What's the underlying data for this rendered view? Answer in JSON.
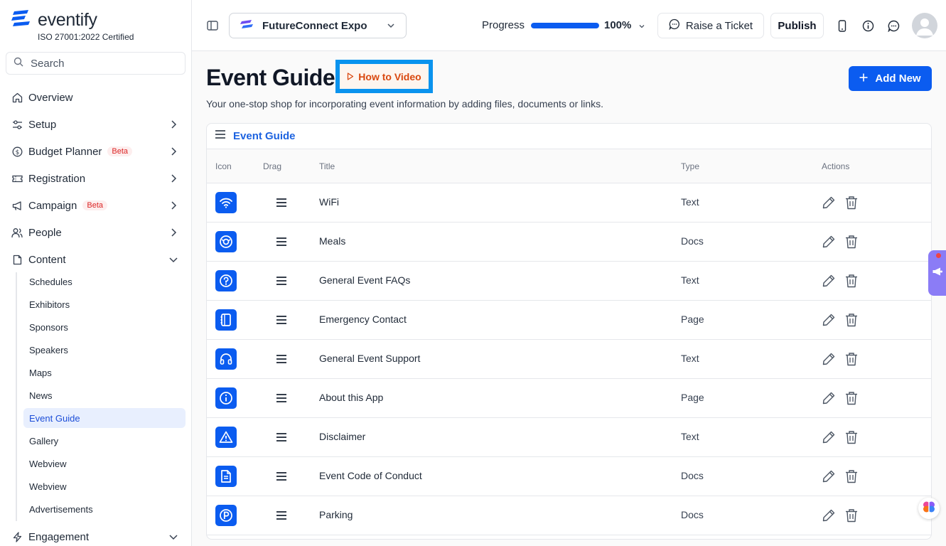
{
  "brand": {
    "name": "eventify",
    "cert": "ISO 27001:2022 Certified",
    "color": "#0b5cf0"
  },
  "search": {
    "placeholder": "Search"
  },
  "sidebar": {
    "items": [
      {
        "label": "Overview",
        "icon": "home-icon"
      },
      {
        "label": "Setup",
        "icon": "sliders-icon"
      },
      {
        "label": "Budget Planner",
        "icon": "dollar-circle-icon",
        "badge": "Beta"
      },
      {
        "label": "Registration",
        "icon": "ticket-icon"
      },
      {
        "label": "Campaign",
        "icon": "megaphone-icon",
        "badge": "Beta"
      },
      {
        "label": "People",
        "icon": "users-icon"
      },
      {
        "label": "Content",
        "icon": "content-icon"
      },
      {
        "label": "Engagement",
        "icon": "bolt-icon"
      }
    ],
    "sub_items": [
      "Schedules",
      "Exhibitors",
      "Sponsors",
      "Speakers",
      "Maps",
      "News",
      "Event Guide",
      "Gallery",
      "Webview",
      "Webview",
      "Advertisements"
    ],
    "active_sub": "Event Guide"
  },
  "topbar": {
    "event_name": "FutureConnect Expo",
    "progress_label": "Progress",
    "progress_value": "100%",
    "progress_fraction": 1.0,
    "ticket_label": "Raise a Ticket",
    "publish_label": "Publish"
  },
  "main": {
    "title": "Event Guide",
    "how_to": "How to Video",
    "subtitle": "Your one-stop shop for incorporating event information by adding files, documents or links.",
    "add_label": "Add New",
    "card_title": "Event Guide",
    "columns": {
      "icon": "Icon",
      "drag": "Drag",
      "title": "Title",
      "type": "Type",
      "actions": "Actions"
    },
    "rows": [
      {
        "title": "WiFi",
        "type": "Text",
        "icon": "wifi-icon"
      },
      {
        "title": "Meals",
        "type": "Docs",
        "icon": "meals-icon"
      },
      {
        "title": "General Event FAQs",
        "type": "Text",
        "icon": "question-icon"
      },
      {
        "title": "Emergency Contact",
        "type": "Page",
        "icon": "contact-book-icon"
      },
      {
        "title": "General Event Support",
        "type": "Text",
        "icon": "headphones-icon"
      },
      {
        "title": "About this App",
        "type": "Page",
        "icon": "info-icon"
      },
      {
        "title": "Disclaimer",
        "type": "Text",
        "icon": "warning-icon"
      },
      {
        "title": "Event Code of Conduct",
        "type": "Docs",
        "icon": "document-icon"
      },
      {
        "title": "Parking",
        "type": "Docs",
        "icon": "parking-icon"
      }
    ]
  },
  "colors": {
    "accent": "#0b5cf0",
    "beta": "#dc2626",
    "howto": "#d9480f"
  }
}
